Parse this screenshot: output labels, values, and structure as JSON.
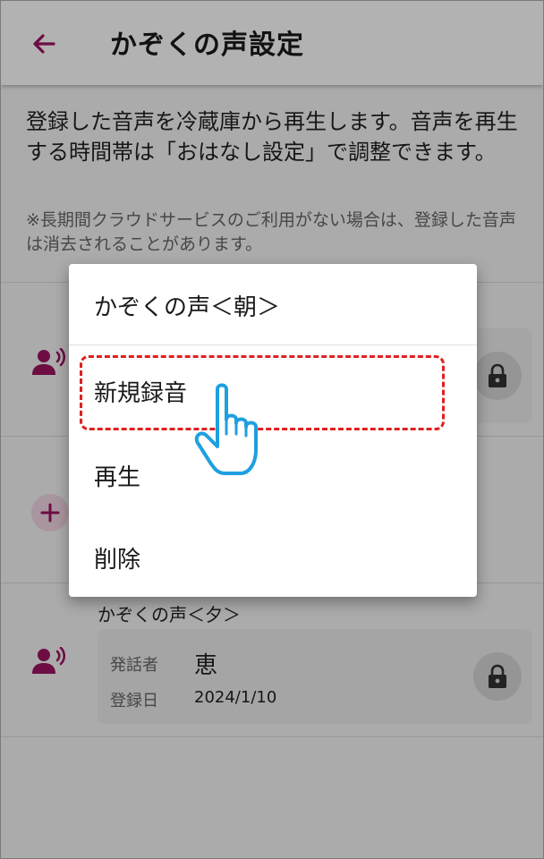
{
  "app": {
    "title": "かぞくの声設定",
    "accent_color": "#9c1461",
    "back_icon": "arrow-left-icon"
  },
  "intro": {
    "description": "登録した音声を冷蔵庫から再生します。音声を再生する時間帯は「おはなし設定」で調整できます。",
    "note": "※長期間クラウドサービスのご利用がない場合は、登録した音声は消去されることがあります。"
  },
  "voices": [
    {
      "slot_label": "かぞくの声＜朝＞",
      "icon": "speaking-person-icon",
      "lock_icon": "lock-icon"
    },
    {
      "add_icon": "plus-icon"
    },
    {
      "slot_label": "かぞくの声＜夕＞",
      "icon": "speaking-person-icon",
      "speaker_label": "発話者",
      "speaker_value": "恵",
      "date_label": "登録日",
      "date_value": "2024/1/10",
      "lock_icon": "lock-icon"
    }
  ],
  "dialog": {
    "title": "かぞくの声＜朝＞",
    "items": [
      {
        "label": "新規録音",
        "highlighted": true
      },
      {
        "label": "再生"
      },
      {
        "label": "削除"
      }
    ]
  },
  "annotation": {
    "highlight_color": "#e02020",
    "pointer_icon": "pointing-hand-icon",
    "pointer_color": "#1ea0e0"
  }
}
